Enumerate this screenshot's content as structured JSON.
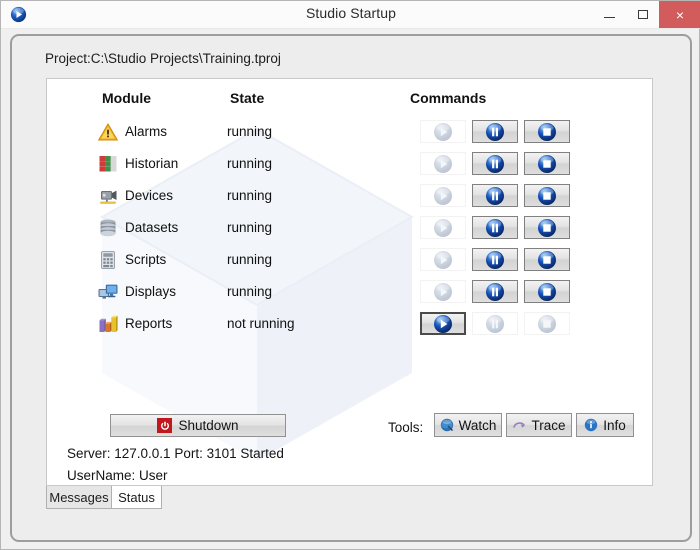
{
  "window": {
    "title": "Studio Startup",
    "icon": "play-circle-icon",
    "controls": {
      "minimize": "minimize-button",
      "maximize": "maximize-button",
      "close": "close-button",
      "close_glyph": "×",
      "close_color": "#d25b5b"
    }
  },
  "project": {
    "path_label": "Project:C:\\Studio Projects\\Training.tproj"
  },
  "table": {
    "headers": {
      "module": "Module",
      "state": "State",
      "commands": "Commands"
    },
    "rows": [
      {
        "icon": "warning-triangle-icon",
        "module": "Alarms",
        "state": "running",
        "play_enabled": false,
        "play_focused": false,
        "pause_enabled": true,
        "stop_enabled": true
      },
      {
        "icon": "historian-layers-icon",
        "module": "Historian",
        "state": "running",
        "play_enabled": false,
        "play_focused": false,
        "pause_enabled": true,
        "stop_enabled": true
      },
      {
        "icon": "device-camera-icon",
        "module": "Devices",
        "state": "running",
        "play_enabled": false,
        "play_focused": false,
        "pause_enabled": true,
        "stop_enabled": true
      },
      {
        "icon": "database-icon",
        "module": "Datasets",
        "state": "running",
        "play_enabled": false,
        "play_focused": false,
        "pause_enabled": true,
        "stop_enabled": true
      },
      {
        "icon": "script-pad-icon",
        "module": "Scripts",
        "state": "running",
        "play_enabled": false,
        "play_focused": false,
        "pause_enabled": true,
        "stop_enabled": true
      },
      {
        "icon": "displays-monitor-icon",
        "module": "Displays",
        "state": "running",
        "play_enabled": false,
        "play_focused": false,
        "pause_enabled": true,
        "stop_enabled": true
      },
      {
        "icon": "report-chart-icon",
        "module": "Reports",
        "state": "not running",
        "play_enabled": true,
        "play_focused": true,
        "pause_enabled": false,
        "stop_enabled": false
      }
    ],
    "command_names": {
      "play": "start-button",
      "pause": "pause-button",
      "stop": "stop-button"
    }
  },
  "footer": {
    "shutdown_label": "Shutdown",
    "shutdown_icon": "power-icon",
    "shutdown_icon_color": "#c0181c",
    "server_line": "Server: 127.0.0.1 Port: 3101   Started",
    "user_line": "UserName: User",
    "tools_label": "Tools:",
    "tools": [
      {
        "label": "Watch",
        "icon": "watch-globe-icon"
      },
      {
        "label": "Trace",
        "icon": "trace-arrow-icon"
      },
      {
        "label": "Info",
        "icon": "info-circle-icon"
      }
    ]
  },
  "tabs": [
    {
      "label": "Messages",
      "active": false
    },
    {
      "label": "Status",
      "active": true
    }
  ]
}
